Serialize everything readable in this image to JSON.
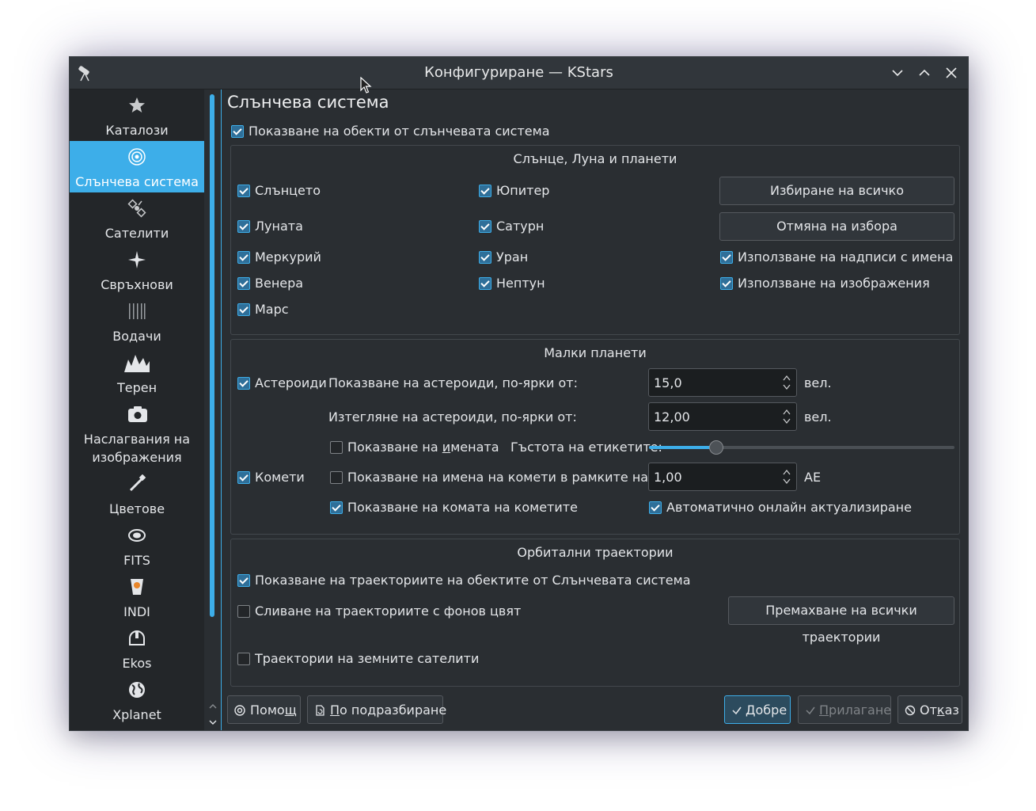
{
  "window": {
    "title": "Конфигуриране — KStars"
  },
  "sidebar": {
    "items": [
      {
        "label": "Каталози",
        "icon": "star-icon"
      },
      {
        "label": "Слънчева система",
        "icon": "solar-system-icon"
      },
      {
        "label": "Сателити",
        "icon": "satellite-icon"
      },
      {
        "label": "Свръхнови",
        "icon": "supernova-icon"
      },
      {
        "label": "Водачи",
        "icon": "guides-icon"
      },
      {
        "label": "Терен",
        "icon": "terrain-icon"
      },
      {
        "label": "Наслагвания на изображения",
        "icon": "camera-icon"
      },
      {
        "label": "Цветове",
        "icon": "color-picker-icon"
      },
      {
        "label": "FITS",
        "icon": "fits-icon"
      },
      {
        "label": "INDI",
        "icon": "indi-icon"
      },
      {
        "label": "Ekos",
        "icon": "ekos-icon"
      },
      {
        "label": "Xplanet",
        "icon": "globe-icon"
      }
    ],
    "active_index": 1
  },
  "page": {
    "title": "Слънчева система",
    "show_solar_objects": "Показване на обекти от слънчевата система"
  },
  "planets_group": {
    "title": "Слънце, Луна и планети",
    "sun": "Слънцето",
    "moon": "Луната",
    "mercury": "Меркурий",
    "venus": "Венера",
    "mars": "Марс",
    "jupiter": "Юпитер",
    "saturn": "Сатурн",
    "uranus": "Уран",
    "neptune": "Нептун",
    "select_all": "Избиране на всичко",
    "deselect": "Отмяна на избора",
    "use_name_labels": "Използване на надписи с имена",
    "use_images": "Използване на изображения"
  },
  "minor_group": {
    "title": "Малки планети",
    "asteroids": "Астероиди",
    "show_asteroids_brighter": "Показване на астероиди, по-ярки от:",
    "show_asteroids_value": "15,0",
    "draw_asteroids_brighter": "Изтегляне на астероиди, по-ярки от:",
    "draw_asteroids_value": "12,00",
    "unit_mag": "вел.",
    "show_names_pre": "Показване на ",
    "show_names_ul": "и",
    "show_names_post": "мената",
    "label_density": "Гъстота на етикетите:",
    "label_density_level": 0.22,
    "comets": "Комети",
    "show_comet_names": "Показване на имена на комети в рамките на:",
    "comet_distance_value": "1,00",
    "unit_au": "АЕ",
    "show_coma": "Показване на комата на кометите",
    "auto_update": "Автоматично онлайн актуализиране"
  },
  "orbit_group": {
    "title": "Орбитални траектории",
    "show_trails": "Показване на траекториите на обектите от Слънчевата система",
    "fade_trails": "Сливане на траекториите с фонов цвят",
    "remove_all": "Премахване на всички траектории",
    "satellite_trails": "Траектории на земните сателити"
  },
  "footer": {
    "help_pre": "Помо",
    "help_ul": "щ",
    "defaults_ul": "П",
    "defaults_post": "о подразбиране",
    "ok_ul": "Д",
    "ok_post": "обре",
    "apply_ul": "П",
    "apply_post": "рилагане",
    "cancel_pre": "От",
    "cancel_ul": "к",
    "cancel_post": "аз"
  },
  "colors": {
    "accent": "#3daee9",
    "window_bg": "#2a2e32",
    "sidebar_bg": "#232629"
  }
}
